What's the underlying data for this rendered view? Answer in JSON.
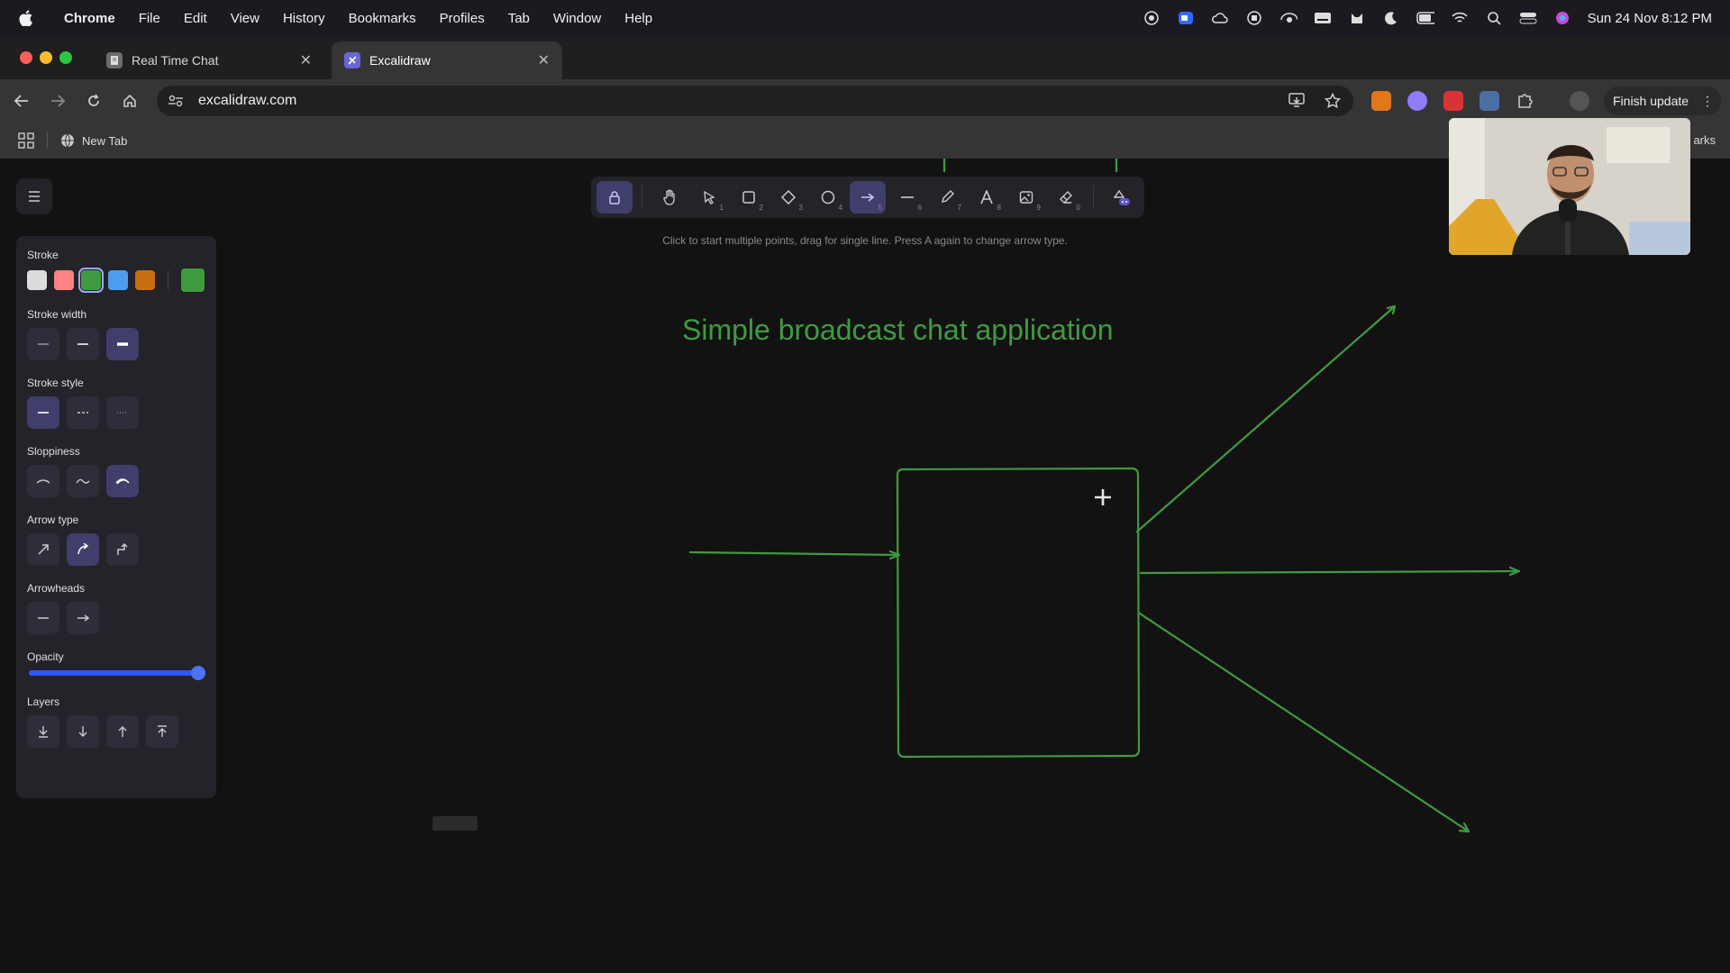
{
  "menubar": {
    "app_name": "Chrome",
    "items": [
      "File",
      "Edit",
      "View",
      "History",
      "Bookmarks",
      "Profiles",
      "Tab",
      "Window",
      "Help"
    ],
    "clock": "Sun 24 Nov  8:12 PM"
  },
  "tabs": [
    {
      "title": "Real Time Chat",
      "favicon": "document-icon",
      "active": false
    },
    {
      "title": "Excalidraw",
      "favicon": "excalidraw-icon",
      "active": true
    }
  ],
  "omnibox": {
    "url": "excalidraw.com"
  },
  "finish_update_label": "Finish update",
  "bookmarks": {
    "items": [
      {
        "label": "New Tab"
      }
    ],
    "overflow_label": "arks"
  },
  "toolbar": {
    "hint": "Click to start multiple points, drag for single line. Press A again to change arrow type.",
    "tools": [
      {
        "name": "lock",
        "key": ""
      },
      {
        "name": "hand",
        "key": ""
      },
      {
        "name": "selection",
        "key": "1"
      },
      {
        "name": "rectangle",
        "key": "2"
      },
      {
        "name": "diamond",
        "key": "3"
      },
      {
        "name": "ellipse",
        "key": "4"
      },
      {
        "name": "arrow",
        "key": "5"
      },
      {
        "name": "line",
        "key": "6"
      },
      {
        "name": "draw",
        "key": "7"
      },
      {
        "name": "text",
        "key": "8"
      },
      {
        "name": "image",
        "key": "9"
      },
      {
        "name": "eraser",
        "key": "0"
      },
      {
        "name": "ai-tools",
        "key": ""
      }
    ],
    "active_tool": "arrow"
  },
  "properties": {
    "stroke_label": "Stroke",
    "stroke_colors": [
      "#dcdcdc",
      "#ff8383",
      "#3f9b3f",
      "#4a9eed",
      "#c76e0f"
    ],
    "selected_stroke": "#3f9b3f",
    "stroke_width_label": "Stroke width",
    "stroke_style_label": "Stroke style",
    "sloppiness_label": "Sloppiness",
    "arrow_type_label": "Arrow type",
    "arrowheads_label": "Arrowheads",
    "opacity_label": "Opacity",
    "opacity_value": 100,
    "layers_label": "Layers"
  },
  "canvas": {
    "title": "Simple broadcast chat application",
    "stroke_color": "#3f9b3f"
  }
}
